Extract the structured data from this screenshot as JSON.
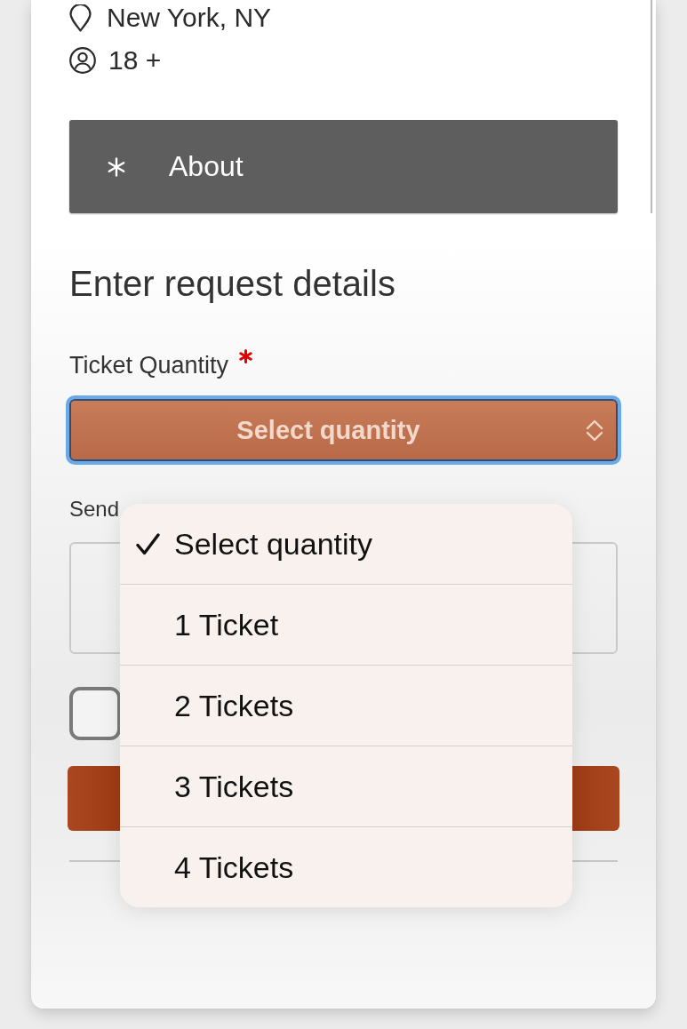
{
  "event_info": {
    "location": "New York, NY",
    "age": "18 +"
  },
  "about": {
    "label": "About"
  },
  "form": {
    "title": "Enter request details",
    "quantity": {
      "label": "Ticket Quantity",
      "required": true,
      "value": "Select quantity",
      "focused": true
    },
    "send": {
      "label": "Send"
    },
    "agree": {
      "checked": false
    }
  },
  "menu": {
    "options": [
      {
        "label": "Select quantity",
        "selected": true
      },
      {
        "label": "1 Ticket",
        "selected": false
      },
      {
        "label": "2 Tickets",
        "selected": false
      },
      {
        "label": "3 Tickets",
        "selected": false
      },
      {
        "label": "4 Tickets",
        "selected": false
      }
    ]
  }
}
